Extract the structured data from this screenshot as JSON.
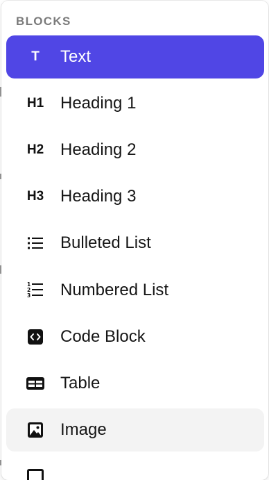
{
  "menu": {
    "header": "BLOCKS",
    "items": [
      {
        "label": "Text",
        "icon": "T",
        "icon_name": "text-icon",
        "state": "selected"
      },
      {
        "label": "Heading 1",
        "icon": "H1",
        "icon_name": "heading-1-icon",
        "state": "default"
      },
      {
        "label": "Heading 2",
        "icon": "H2",
        "icon_name": "heading-2-icon",
        "state": "default"
      },
      {
        "label": "Heading 3",
        "icon": "H3",
        "icon_name": "heading-3-icon",
        "state": "default"
      },
      {
        "label": "Bulleted List",
        "icon": "",
        "icon_name": "bulleted-list-icon",
        "state": "default"
      },
      {
        "label": "Numbered List",
        "icon": "",
        "icon_name": "numbered-list-icon",
        "state": "default"
      },
      {
        "label": "Code Block",
        "icon": "",
        "icon_name": "code-block-icon",
        "state": "default"
      },
      {
        "label": "Table",
        "icon": "",
        "icon_name": "table-icon",
        "state": "default"
      },
      {
        "label": "Image",
        "icon": "",
        "icon_name": "image-icon",
        "state": "hovered"
      }
    ]
  },
  "colors": {
    "selected_bg": "#5046e5",
    "hover_bg": "#f3f3f3",
    "header_text": "#7b7b7b",
    "label_text": "#161616"
  }
}
